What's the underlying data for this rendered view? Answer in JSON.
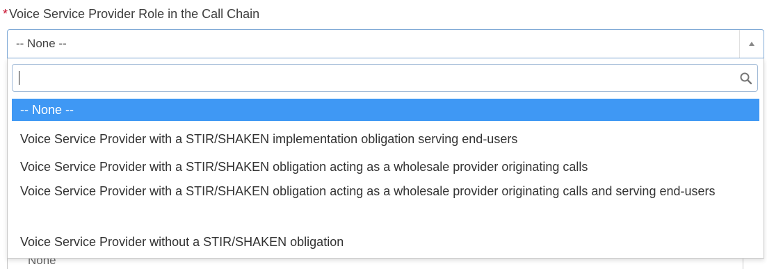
{
  "field": {
    "required_marker": "*",
    "label": "Voice Service Provider Role in the Call Chain",
    "selected_value": "-- None --"
  },
  "dropdown": {
    "search_value": "",
    "search_icon": "search-icon",
    "options": [
      {
        "label": "-- None --",
        "selected": true
      },
      {
        "label": "Voice Service Provider with a STIR/SHAKEN implementation obligation serving end-users",
        "selected": false
      },
      {
        "label": "Voice Service Provider with a STIR/SHAKEN obligation acting as a wholesale provider originating calls",
        "selected": false
      },
      {
        "label": "Voice Service Provider with a STIR/SHAKEN obligation acting as a wholesale provider originating calls and serving end-users",
        "selected": false
      },
      {
        "label": "Voice Service Provider without a STIR/SHAKEN obligation",
        "selected": false
      }
    ]
  },
  "underlay": {
    "value": "None"
  },
  "colors": {
    "required": "#c8102e",
    "selected_option_bg": "#3f98f4",
    "focus_border": "#7fa9d6"
  }
}
